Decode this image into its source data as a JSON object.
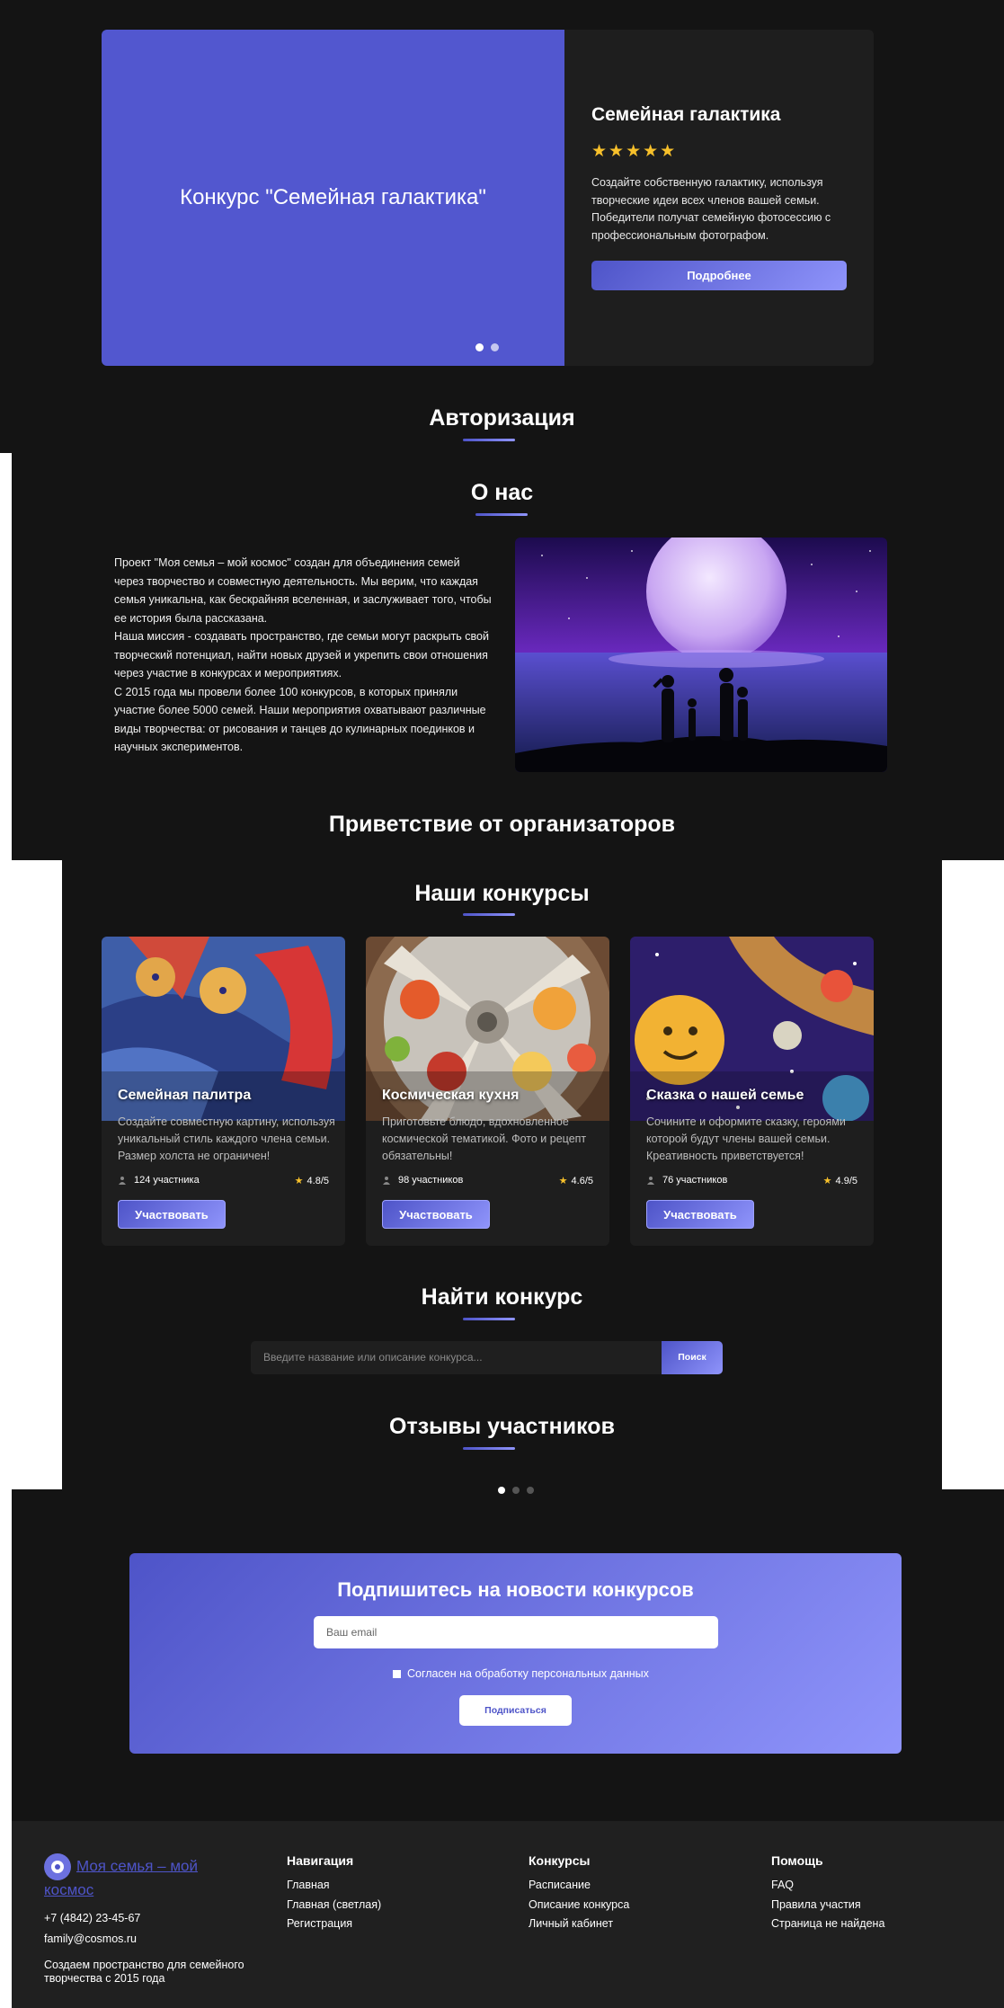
{
  "hero": {
    "slide_title": "Конкурс \"Семейная галактика\"",
    "title": "Семейная галактика",
    "stars": "★★★★★",
    "description": "Создайте собственную галактику, используя творческие идеи всех членов вашей семьи. Победители получат семейную фотосессию с профессиональным фотографом.",
    "button": "Подробнее",
    "colors": {
      "slide": "#5257cf",
      "accent": "#4e54c8",
      "accent2": "#8f94fb"
    }
  },
  "auth": {
    "title": "Авторизация"
  },
  "about": {
    "title": "О нас",
    "p1": "Проект \"Моя семья – мой космос\" создан для объединения семей через творчество и совместную деятельность. Мы верим, что каждая семья уникальна, как бескрайняя вселенная, и заслуживает того, чтобы ее история была рассказана.",
    "p2": "Наша миссия - создавать пространство, где семьи могут раскрыть свой творческий потенциал, найти новых друзей и укрепить свои отношения через участие в конкурсах и мероприятиях.",
    "p3": "С 2015 года мы провели более 100 конкурсов, в которых приняли участие более 5000 семей. Наши мероприятия охватывают различные виды творчества: от рисования и танцев до кулинарных поединков и научных экспериментов."
  },
  "greeting": {
    "title": "Приветствие от организаторов"
  },
  "contests": {
    "title": "Наши конкурсы",
    "items": [
      {
        "title": "Семейная палитра",
        "description": "Создайте совместную картину, используя уникальный стиль каждого члена семьи. Размер холста не ограничен!",
        "participants": "124 участника",
        "rating": "4.8/5",
        "button": "Участвовать"
      },
      {
        "title": "Космическая кухня",
        "description": "Приготовьте блюдо, вдохновленное космической тематикой. Фото и рецепт обязательны!",
        "participants": "98 участников",
        "rating": "4.6/5",
        "button": "Участвовать"
      },
      {
        "title": "Сказка о нашей семье",
        "description": "Сочините и оформите сказку, героями которой будут члены вашей семьи. Креативность приветствуется!",
        "participants": "76 участников",
        "rating": "4.9/5",
        "button": "Участвовать"
      }
    ]
  },
  "search": {
    "title": "Найти конкурс",
    "placeholder": "Введите название или описание конкурса...",
    "button": "Поиск"
  },
  "reviews": {
    "title": "Отзывы участников"
  },
  "subscribe": {
    "title": "Подпишитесь на новости конкурсов",
    "placeholder": "Ваш email",
    "consent": "Согласен на обработку персональных данных",
    "button": "Подписаться"
  },
  "footer": {
    "logo": "Моя семья – мой космос",
    "phone": "+7 (4842) 23-45-67",
    "email": "family@cosmos.ru",
    "tagline": "Создаем пространство для семейного творчества с 2015 года",
    "nav": {
      "title": "Навигация",
      "links": [
        "Главная",
        "Главная (светлая)",
        "Регистрация"
      ]
    },
    "contests": {
      "title": "Конкурсы",
      "links": [
        "Расписание",
        "Описание конкурса",
        "Личный кабинет"
      ]
    },
    "help": {
      "title": "Помощь",
      "links": [
        "FAQ",
        "Правила участия",
        "Страница не найдена"
      ]
    }
  }
}
